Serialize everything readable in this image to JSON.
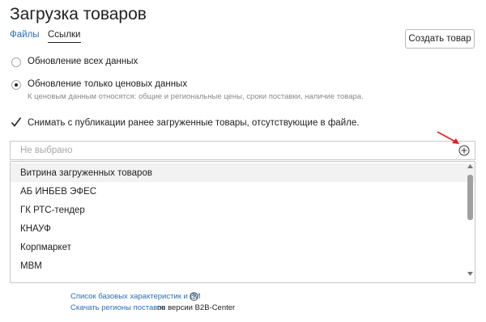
{
  "page": {
    "title": "Загрузка товаров"
  },
  "tabs": [
    {
      "label": "Файлы"
    },
    {
      "label": "Ссылки"
    }
  ],
  "buttons": {
    "create": "Создать товар"
  },
  "options": {
    "all_data": "Обновление всех данных",
    "prices_only": "Обновление только ценовых данных",
    "prices_hint": "К ценовым данным относятся: общие и региональные цены, сроки поставки, наличие товара.",
    "selected": "prices_only"
  },
  "checkbox": {
    "label": "Снимать с публикации ранее загруженные товары, отсутствующие в файле.",
    "checked": true
  },
  "select": {
    "placeholder": "Не выбрано",
    "items": [
      "Витрина загруженных товаров",
      "АБ ИНБЕВ ЭФЕС",
      "ГК РТС-тендер",
      "КНАУФ",
      "Корпмаркет",
      "МВМ"
    ]
  },
  "footer": {
    "link1": "Список базовых характеристик и ЕИ",
    "link2": "Скачать регионы поставок",
    "link2_suffix": "по версии B2B-Center"
  },
  "icons": {
    "add": "add-circle-icon",
    "annotation": "red-arrow-icon",
    "help": "question-circle-icon",
    "check": "checkmark-icon"
  },
  "colors": {
    "link": "#2a6ebb",
    "annotation": "#e02020",
    "muted": "#8a8a8a"
  }
}
